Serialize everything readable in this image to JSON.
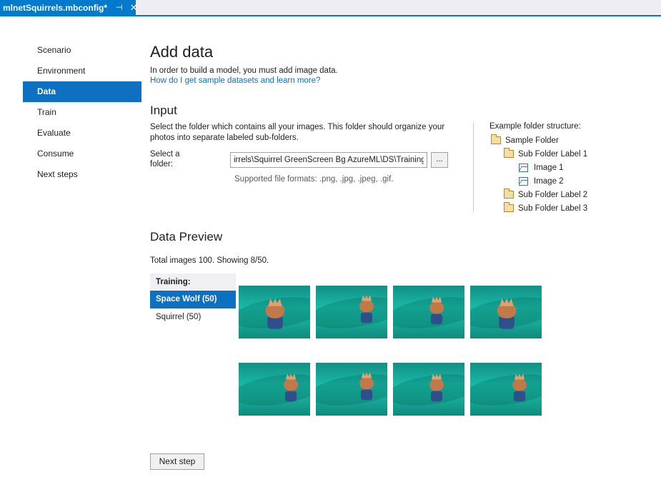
{
  "tab": {
    "title": "mlnetSquirrels.mbconfig*",
    "pin_glyph": "⊣",
    "close_glyph": "✕"
  },
  "sidebar": {
    "items": [
      {
        "label": "Scenario"
      },
      {
        "label": "Environment"
      },
      {
        "label": "Data",
        "active": true
      },
      {
        "label": "Train"
      },
      {
        "label": "Evaluate"
      },
      {
        "label": "Consume"
      },
      {
        "label": "Next steps"
      }
    ]
  },
  "main": {
    "title": "Add data",
    "intro": "In order to build a model, you must add image data.",
    "help_link": "How do I get sample datasets and learn more?"
  },
  "input": {
    "title": "Input",
    "description": "Select the folder which contains all your images. This folder should organize your photos into separate labeled sub-folders.",
    "folder_label": "Select a folder:",
    "folder_value": "irrels\\Squirrel GreenScreen Bg AzureML\\DS\\Training",
    "browse_label": "...",
    "formats": "Supported file formats: .png, .jpg, .jpeg, .gif."
  },
  "example": {
    "title": "Example folder structure:",
    "tree": [
      {
        "label": "Sample Folder",
        "type": "folder",
        "indent": 0
      },
      {
        "label": "Sub Folder Label 1",
        "type": "folder",
        "indent": 1
      },
      {
        "label": "Image 1",
        "type": "image",
        "indent": 2
      },
      {
        "label": "Image 2",
        "type": "image",
        "indent": 2
      },
      {
        "label": "Sub Folder Label 2",
        "type": "folder",
        "indent": 1
      },
      {
        "label": "Sub Folder Label 3",
        "type": "folder",
        "indent": 1
      }
    ]
  },
  "preview": {
    "title": "Data Preview",
    "total": "Total images 100. Showing 8/50.",
    "list_header": "Training:",
    "labels": [
      {
        "label": "Space Wolf (50)",
        "active": true
      },
      {
        "label": "Squirrel (50)"
      }
    ],
    "thumbnail_count": 8
  },
  "footer": {
    "next_label": "Next step"
  },
  "colors": {
    "accent": "#007acc",
    "selection": "#0e70c0",
    "link": "#0e70c0",
    "thumb_teal": "#19b8a6"
  }
}
